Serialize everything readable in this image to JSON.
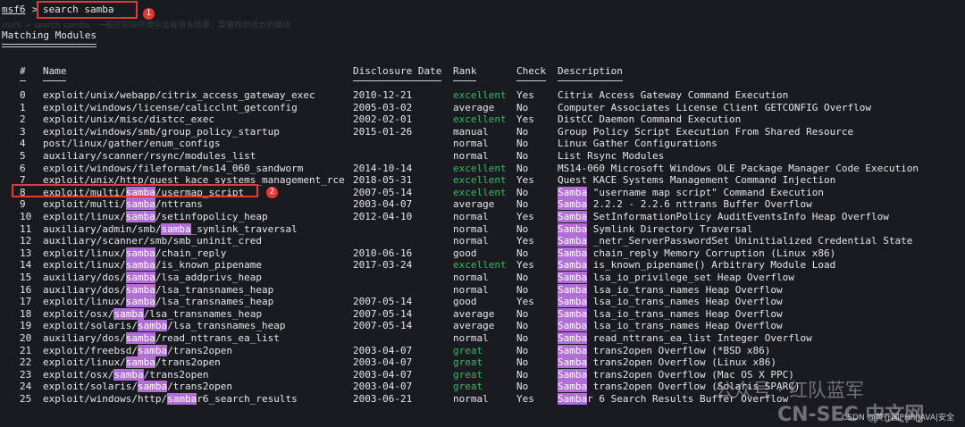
{
  "prompt": {
    "name": "msf6",
    "symbol": ">",
    "command": "search samba",
    "badge": "1"
  },
  "faint_overlay": "msf6 > search samba   一般在实际环境中会有很多结果，需要找到适合的模块",
  "section_title": "Matching Modules",
  "headers": {
    "num": "#",
    "name": "Name",
    "date": "Disclosure Date",
    "rank": "Rank",
    "check": "Check",
    "desc": "Description"
  },
  "highlight_badge": "2",
  "rows": [
    {
      "n": "0",
      "pre": "exploit/unix/webapp/citrix_access_gateway_exec",
      "hl": "",
      "post": "",
      "date": "2010-12-21",
      "rank": "excellent",
      "check": "Yes",
      "dhl": "",
      "desc": "Citrix Access Gateway Command Execution"
    },
    {
      "n": "1",
      "pre": "exploit/windows/license/calicclnt_getconfig",
      "hl": "",
      "post": "",
      "date": "2005-03-02",
      "rank": "average",
      "check": "No",
      "dhl": "",
      "desc": "Computer Associates License Client GETCONFIG Overflow"
    },
    {
      "n": "2",
      "pre": "exploit/unix/misc/distcc_exec",
      "hl": "",
      "post": "",
      "date": "2002-02-01",
      "rank": "excellent",
      "check": "Yes",
      "dhl": "",
      "desc": "DistCC Daemon Command Execution"
    },
    {
      "n": "3",
      "pre": "exploit/windows/smb/group_policy_startup",
      "hl": "",
      "post": "",
      "date": "2015-01-26",
      "rank": "manual",
      "check": "No",
      "dhl": "",
      "desc": "Group Policy Script Execution From Shared Resource"
    },
    {
      "n": "4",
      "pre": "post/linux/gather/enum_configs",
      "hl": "",
      "post": "",
      "date": "",
      "rank": "normal",
      "check": "No",
      "dhl": "",
      "desc": "Linux Gather Configurations"
    },
    {
      "n": "5",
      "pre": "auxiliary/scanner/rsync/modules_list",
      "hl": "",
      "post": "",
      "date": "",
      "rank": "normal",
      "check": "No",
      "dhl": "",
      "desc": "List Rsync Modules"
    },
    {
      "n": "6",
      "pre": "exploit/windows/fileformat/ms14_060_sandworm",
      "hl": "",
      "post": "",
      "date": "2014-10-14",
      "rank": "excellent",
      "check": "No",
      "dhl": "",
      "desc": "MS14-060 Microsoft Windows OLE Package Manager Code Execution"
    },
    {
      "n": "7",
      "pre": "exploit/unix/http/quest_kace_systems_management_rce",
      "hl": "",
      "post": "",
      "date": "2018-05-31",
      "rank": "excellent",
      "check": "Yes",
      "dhl": "",
      "desc": "Quest KACE Systems Management Command Injection"
    },
    {
      "n": "8",
      "pre": "exploit/multi/",
      "hl": "samba",
      "post": "/usermap_script",
      "date": "2007-05-14",
      "rank": "excellent",
      "check": "No",
      "dhl": "Samba",
      "desc": " \"username map script\" Command Execution"
    },
    {
      "n": "9",
      "pre": "exploit/multi/",
      "hl": "samba",
      "post": "/nttrans",
      "date": "2003-04-07",
      "rank": "average",
      "check": "No",
      "dhl": "Samba",
      "desc": " 2.2.2 - 2.2.6 nttrans Buffer Overflow"
    },
    {
      "n": "10",
      "pre": "exploit/linux/",
      "hl": "samba",
      "post": "/setinfopolicy_heap",
      "date": "2012-04-10",
      "rank": "normal",
      "check": "Yes",
      "dhl": "Samba",
      "desc": " SetInformationPolicy AuditEventsInfo Heap Overflow"
    },
    {
      "n": "11",
      "pre": "auxiliary/admin/smb/",
      "hl": "samba",
      "post": "_symlink_traversal",
      "date": "",
      "rank": "normal",
      "check": "No",
      "dhl": "Samba",
      "desc": " Symlink Directory Traversal"
    },
    {
      "n": "12",
      "pre": "auxiliary/scanner/smb/smb_uninit_cred",
      "hl": "",
      "post": "",
      "date": "",
      "rank": "normal",
      "check": "Yes",
      "dhl": "Samba",
      "desc": " _netr_ServerPasswordSet Uninitialized Credential State"
    },
    {
      "n": "13",
      "pre": "exploit/linux/",
      "hl": "samba",
      "post": "/chain_reply",
      "date": "2010-06-16",
      "rank": "good",
      "check": "No",
      "dhl": "Samba",
      "desc": " chain_reply Memory Corruption (Linux x86)"
    },
    {
      "n": "14",
      "pre": "exploit/linux/",
      "hl": "samba",
      "post": "/is_known_pipename",
      "date": "2017-03-24",
      "rank": "excellent",
      "check": "Yes",
      "dhl": "Samba",
      "desc": " is_known_pipename() Arbitrary Module Load"
    },
    {
      "n": "15",
      "pre": "auxiliary/dos/",
      "hl": "samba",
      "post": "/lsa_addprivs_heap",
      "date": "",
      "rank": "normal",
      "check": "No",
      "dhl": "Samba",
      "desc": " lsa_io_privilege_set Heap Overflow"
    },
    {
      "n": "16",
      "pre": "auxiliary/dos/",
      "hl": "samba",
      "post": "/lsa_transnames_heap",
      "date": "",
      "rank": "normal",
      "check": "No",
      "dhl": "Samba",
      "desc": " lsa_io_trans_names Heap Overflow"
    },
    {
      "n": "17",
      "pre": "exploit/linux/",
      "hl": "samba",
      "post": "/lsa_transnames_heap",
      "date": "2007-05-14",
      "rank": "good",
      "check": "Yes",
      "dhl": "Samba",
      "desc": " lsa_io_trans_names Heap Overflow"
    },
    {
      "n": "18",
      "pre": "exploit/osx/",
      "hl": "samba",
      "post": "/lsa_transnames_heap",
      "date": "2007-05-14",
      "rank": "average",
      "check": "No",
      "dhl": "Samba",
      "desc": " lsa_io_trans_names Heap Overflow"
    },
    {
      "n": "19",
      "pre": "exploit/solaris/",
      "hl": "samba",
      "post": "/lsa_transnames_heap",
      "date": "2007-05-14",
      "rank": "average",
      "check": "No",
      "dhl": "Samba",
      "desc": " lsa_io_trans_names Heap Overflow"
    },
    {
      "n": "20",
      "pre": "auxiliary/dos/",
      "hl": "samba",
      "post": "/read_nttrans_ea_list",
      "date": "",
      "rank": "normal",
      "check": "No",
      "dhl": "Samba",
      "desc": " read_nttrans_ea_list Integer Overflow"
    },
    {
      "n": "21",
      "pre": "exploit/freebsd/",
      "hl": "samba",
      "post": "/trans2open",
      "date": "2003-04-07",
      "rank": "great",
      "check": "No",
      "dhl": "Samba",
      "desc": " trans2open Overflow (*BSD x86)"
    },
    {
      "n": "22",
      "pre": "exploit/linux/",
      "hl": "samba",
      "post": "/trans2open",
      "date": "2003-04-07",
      "rank": "great",
      "check": "No",
      "dhl": "Samba",
      "desc": " trans2open Overflow (Linux x86)"
    },
    {
      "n": "23",
      "pre": "exploit/osx/",
      "hl": "samba",
      "post": "/trans2open",
      "date": "2003-04-07",
      "rank": "great",
      "check": "No",
      "dhl": "Samba",
      "desc": " trans2open Overflow (Mac OS X PPC)"
    },
    {
      "n": "24",
      "pre": "exploit/solaris/",
      "hl": "samba",
      "post": "/trans2open",
      "date": "2003-04-07",
      "rank": "great",
      "check": "No",
      "dhl": "Samba",
      "desc": " trans2open Overflow (Solaris SPARC)"
    },
    {
      "n": "25",
      "pre": "exploit/windows/http/",
      "hl": "samba",
      "post": "r6_search_results",
      "date": "2003-06-21",
      "rank": "normal",
      "check": "Yes",
      "dhl": "Samba",
      "desc": "r 6 Search Results Buffer Overflow"
    }
  ],
  "watermark": {
    "brand": "公众号 · 红队蓝军",
    "site": "CN-SEC 中文网",
    "credit": "CSDN @黄乔国PHP|JAVA|安全"
  },
  "colors": {
    "background": "#1a1b21",
    "text": "#e6e6e6",
    "green": "#3fb56b",
    "highlight": "#b16fd6",
    "annotation": "#e53935"
  }
}
